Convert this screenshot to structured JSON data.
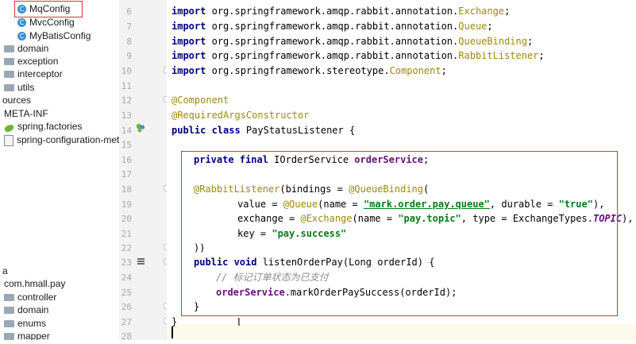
{
  "project_tree": {
    "rows": [
      {
        "label": "MqConfig",
        "icon": "class-icon"
      },
      {
        "label": "MvcConfig",
        "icon": "class-icon"
      },
      {
        "label": "MyBatisConfig",
        "icon": "class-icon"
      },
      {
        "label": "domain",
        "icon": "folder-icon"
      },
      {
        "label": "exception",
        "icon": "folder-icon"
      },
      {
        "label": "interceptor",
        "icon": "folder-icon"
      },
      {
        "label": "utils",
        "icon": "folder-icon"
      },
      {
        "label": "ources",
        "icon": ""
      },
      {
        "label": "META-INF",
        "icon": ""
      },
      {
        "label": "spring.factories",
        "icon": "spring-leaf-icon"
      },
      {
        "label": "spring-configuration-metadat",
        "icon": "file-icon"
      },
      {
        "label": "a",
        "icon": ""
      },
      {
        "label": "com.hmall.pay",
        "icon": ""
      },
      {
        "label": "controller",
        "icon": "folder-icon"
      },
      {
        "label": "domain",
        "icon": "folder-icon"
      },
      {
        "label": "enums",
        "icon": "folder-icon"
      },
      {
        "label": "mapper",
        "icon": "folder-icon"
      }
    ],
    "selected_label": "MqConfig"
  },
  "editor": {
    "line_numbers": [
      "6",
      "7",
      "8",
      "9",
      "10",
      "11",
      "12",
      "13",
      "14",
      "15",
      "16",
      "17",
      "18",
      "19",
      "20",
      "21",
      "22",
      "23",
      "24",
      "25",
      "26",
      "27",
      "28"
    ],
    "imports": {
      "kw": "import",
      "pkg_amqp": "org.springframework.amqp.rabbit.annotation.",
      "pkg_stereo": "org.springframework.stereotype.",
      "names": [
        "Exchange",
        "Queue",
        "QueueBinding",
        "RabbitListener",
        "Component"
      ],
      "semi": ";"
    },
    "ann_component": "@Component",
    "ann_rac": "@RequiredArgsConstructor",
    "class_kw": "public class",
    "class_rest": " PayStatusListener {",
    "field_kw": "private final",
    "field_type": " IOrderService ",
    "field_name": "orderService",
    "field_end": ";",
    "rl_ann": "@RabbitListener",
    "rl_mid": "(bindings = ",
    "qb_ann": "@QueueBinding",
    "qb_open": "(",
    "value_pre": "value = ",
    "queue_ann": "@Queue",
    "queue_mid": "(name = ",
    "queue_name": "\"mark.order.pay.queue\"",
    "durable_mid": ", durable = ",
    "durable_val": "\"true\"",
    "queue_end": "),",
    "exchange_pre": "exchange = ",
    "exchange_ann": "@Exchange",
    "exchange_mid": "(name = ",
    "exchange_name": "\"pay.topic\"",
    "type_mid": ", type = ExchangeTypes.",
    "type_val": "TOPIC",
    "exchange_end": "),",
    "key_pre": "key = ",
    "key_val": "\"pay.success\"",
    "close_ann": "))",
    "method_kw": "public void",
    "method_rest": " listenOrderPay(Long orderId) {",
    "comment": "// 标记订单状态为已支付",
    "call_field": "orderService",
    "call_rest": ".markOrderPaySuccess(orderId);",
    "close_method": "}",
    "close_class": "}"
  }
}
